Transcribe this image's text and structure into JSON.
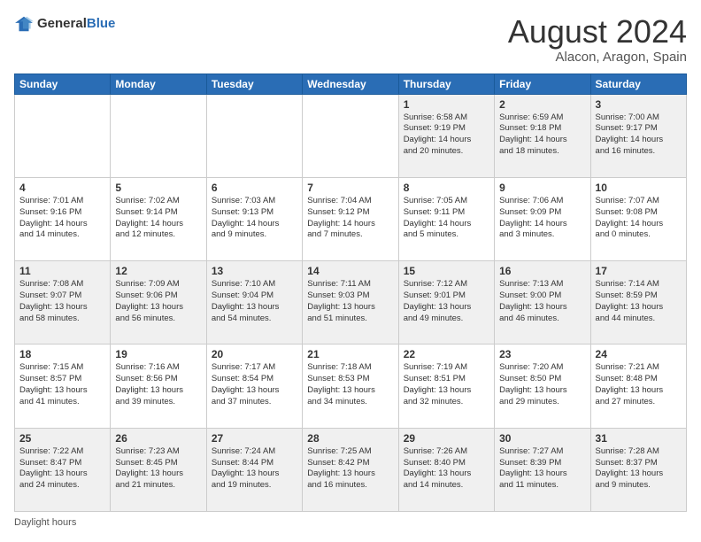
{
  "header": {
    "logo_general": "General",
    "logo_blue": "Blue",
    "month_title": "August 2024",
    "location": "Alacon, Aragon, Spain"
  },
  "footer": {
    "label": "Daylight hours"
  },
  "calendar": {
    "days_of_week": [
      "Sunday",
      "Monday",
      "Tuesday",
      "Wednesday",
      "Thursday",
      "Friday",
      "Saturday"
    ],
    "weeks": [
      [
        {
          "day": "",
          "info": ""
        },
        {
          "day": "",
          "info": ""
        },
        {
          "day": "",
          "info": ""
        },
        {
          "day": "",
          "info": ""
        },
        {
          "day": "1",
          "info": "Sunrise: 6:58 AM\nSunset: 9:19 PM\nDaylight: 14 hours\nand 20 minutes."
        },
        {
          "day": "2",
          "info": "Sunrise: 6:59 AM\nSunset: 9:18 PM\nDaylight: 14 hours\nand 18 minutes."
        },
        {
          "day": "3",
          "info": "Sunrise: 7:00 AM\nSunset: 9:17 PM\nDaylight: 14 hours\nand 16 minutes."
        }
      ],
      [
        {
          "day": "4",
          "info": "Sunrise: 7:01 AM\nSunset: 9:16 PM\nDaylight: 14 hours\nand 14 minutes."
        },
        {
          "day": "5",
          "info": "Sunrise: 7:02 AM\nSunset: 9:14 PM\nDaylight: 14 hours\nand 12 minutes."
        },
        {
          "day": "6",
          "info": "Sunrise: 7:03 AM\nSunset: 9:13 PM\nDaylight: 14 hours\nand 9 minutes."
        },
        {
          "day": "7",
          "info": "Sunrise: 7:04 AM\nSunset: 9:12 PM\nDaylight: 14 hours\nand 7 minutes."
        },
        {
          "day": "8",
          "info": "Sunrise: 7:05 AM\nSunset: 9:11 PM\nDaylight: 14 hours\nand 5 minutes."
        },
        {
          "day": "9",
          "info": "Sunrise: 7:06 AM\nSunset: 9:09 PM\nDaylight: 14 hours\nand 3 minutes."
        },
        {
          "day": "10",
          "info": "Sunrise: 7:07 AM\nSunset: 9:08 PM\nDaylight: 14 hours\nand 0 minutes."
        }
      ],
      [
        {
          "day": "11",
          "info": "Sunrise: 7:08 AM\nSunset: 9:07 PM\nDaylight: 13 hours\nand 58 minutes."
        },
        {
          "day": "12",
          "info": "Sunrise: 7:09 AM\nSunset: 9:06 PM\nDaylight: 13 hours\nand 56 minutes."
        },
        {
          "day": "13",
          "info": "Sunrise: 7:10 AM\nSunset: 9:04 PM\nDaylight: 13 hours\nand 54 minutes."
        },
        {
          "day": "14",
          "info": "Sunrise: 7:11 AM\nSunset: 9:03 PM\nDaylight: 13 hours\nand 51 minutes."
        },
        {
          "day": "15",
          "info": "Sunrise: 7:12 AM\nSunset: 9:01 PM\nDaylight: 13 hours\nand 49 minutes."
        },
        {
          "day": "16",
          "info": "Sunrise: 7:13 AM\nSunset: 9:00 PM\nDaylight: 13 hours\nand 46 minutes."
        },
        {
          "day": "17",
          "info": "Sunrise: 7:14 AM\nSunset: 8:59 PM\nDaylight: 13 hours\nand 44 minutes."
        }
      ],
      [
        {
          "day": "18",
          "info": "Sunrise: 7:15 AM\nSunset: 8:57 PM\nDaylight: 13 hours\nand 41 minutes."
        },
        {
          "day": "19",
          "info": "Sunrise: 7:16 AM\nSunset: 8:56 PM\nDaylight: 13 hours\nand 39 minutes."
        },
        {
          "day": "20",
          "info": "Sunrise: 7:17 AM\nSunset: 8:54 PM\nDaylight: 13 hours\nand 37 minutes."
        },
        {
          "day": "21",
          "info": "Sunrise: 7:18 AM\nSunset: 8:53 PM\nDaylight: 13 hours\nand 34 minutes."
        },
        {
          "day": "22",
          "info": "Sunrise: 7:19 AM\nSunset: 8:51 PM\nDaylight: 13 hours\nand 32 minutes."
        },
        {
          "day": "23",
          "info": "Sunrise: 7:20 AM\nSunset: 8:50 PM\nDaylight: 13 hours\nand 29 minutes."
        },
        {
          "day": "24",
          "info": "Sunrise: 7:21 AM\nSunset: 8:48 PM\nDaylight: 13 hours\nand 27 minutes."
        }
      ],
      [
        {
          "day": "25",
          "info": "Sunrise: 7:22 AM\nSunset: 8:47 PM\nDaylight: 13 hours\nand 24 minutes."
        },
        {
          "day": "26",
          "info": "Sunrise: 7:23 AM\nSunset: 8:45 PM\nDaylight: 13 hours\nand 21 minutes."
        },
        {
          "day": "27",
          "info": "Sunrise: 7:24 AM\nSunset: 8:44 PM\nDaylight: 13 hours\nand 19 minutes."
        },
        {
          "day": "28",
          "info": "Sunrise: 7:25 AM\nSunset: 8:42 PM\nDaylight: 13 hours\nand 16 minutes."
        },
        {
          "day": "29",
          "info": "Sunrise: 7:26 AM\nSunset: 8:40 PM\nDaylight: 13 hours\nand 14 minutes."
        },
        {
          "day": "30",
          "info": "Sunrise: 7:27 AM\nSunset: 8:39 PM\nDaylight: 13 hours\nand 11 minutes."
        },
        {
          "day": "31",
          "info": "Sunrise: 7:28 AM\nSunset: 8:37 PM\nDaylight: 13 hours\nand 9 minutes."
        }
      ]
    ]
  }
}
